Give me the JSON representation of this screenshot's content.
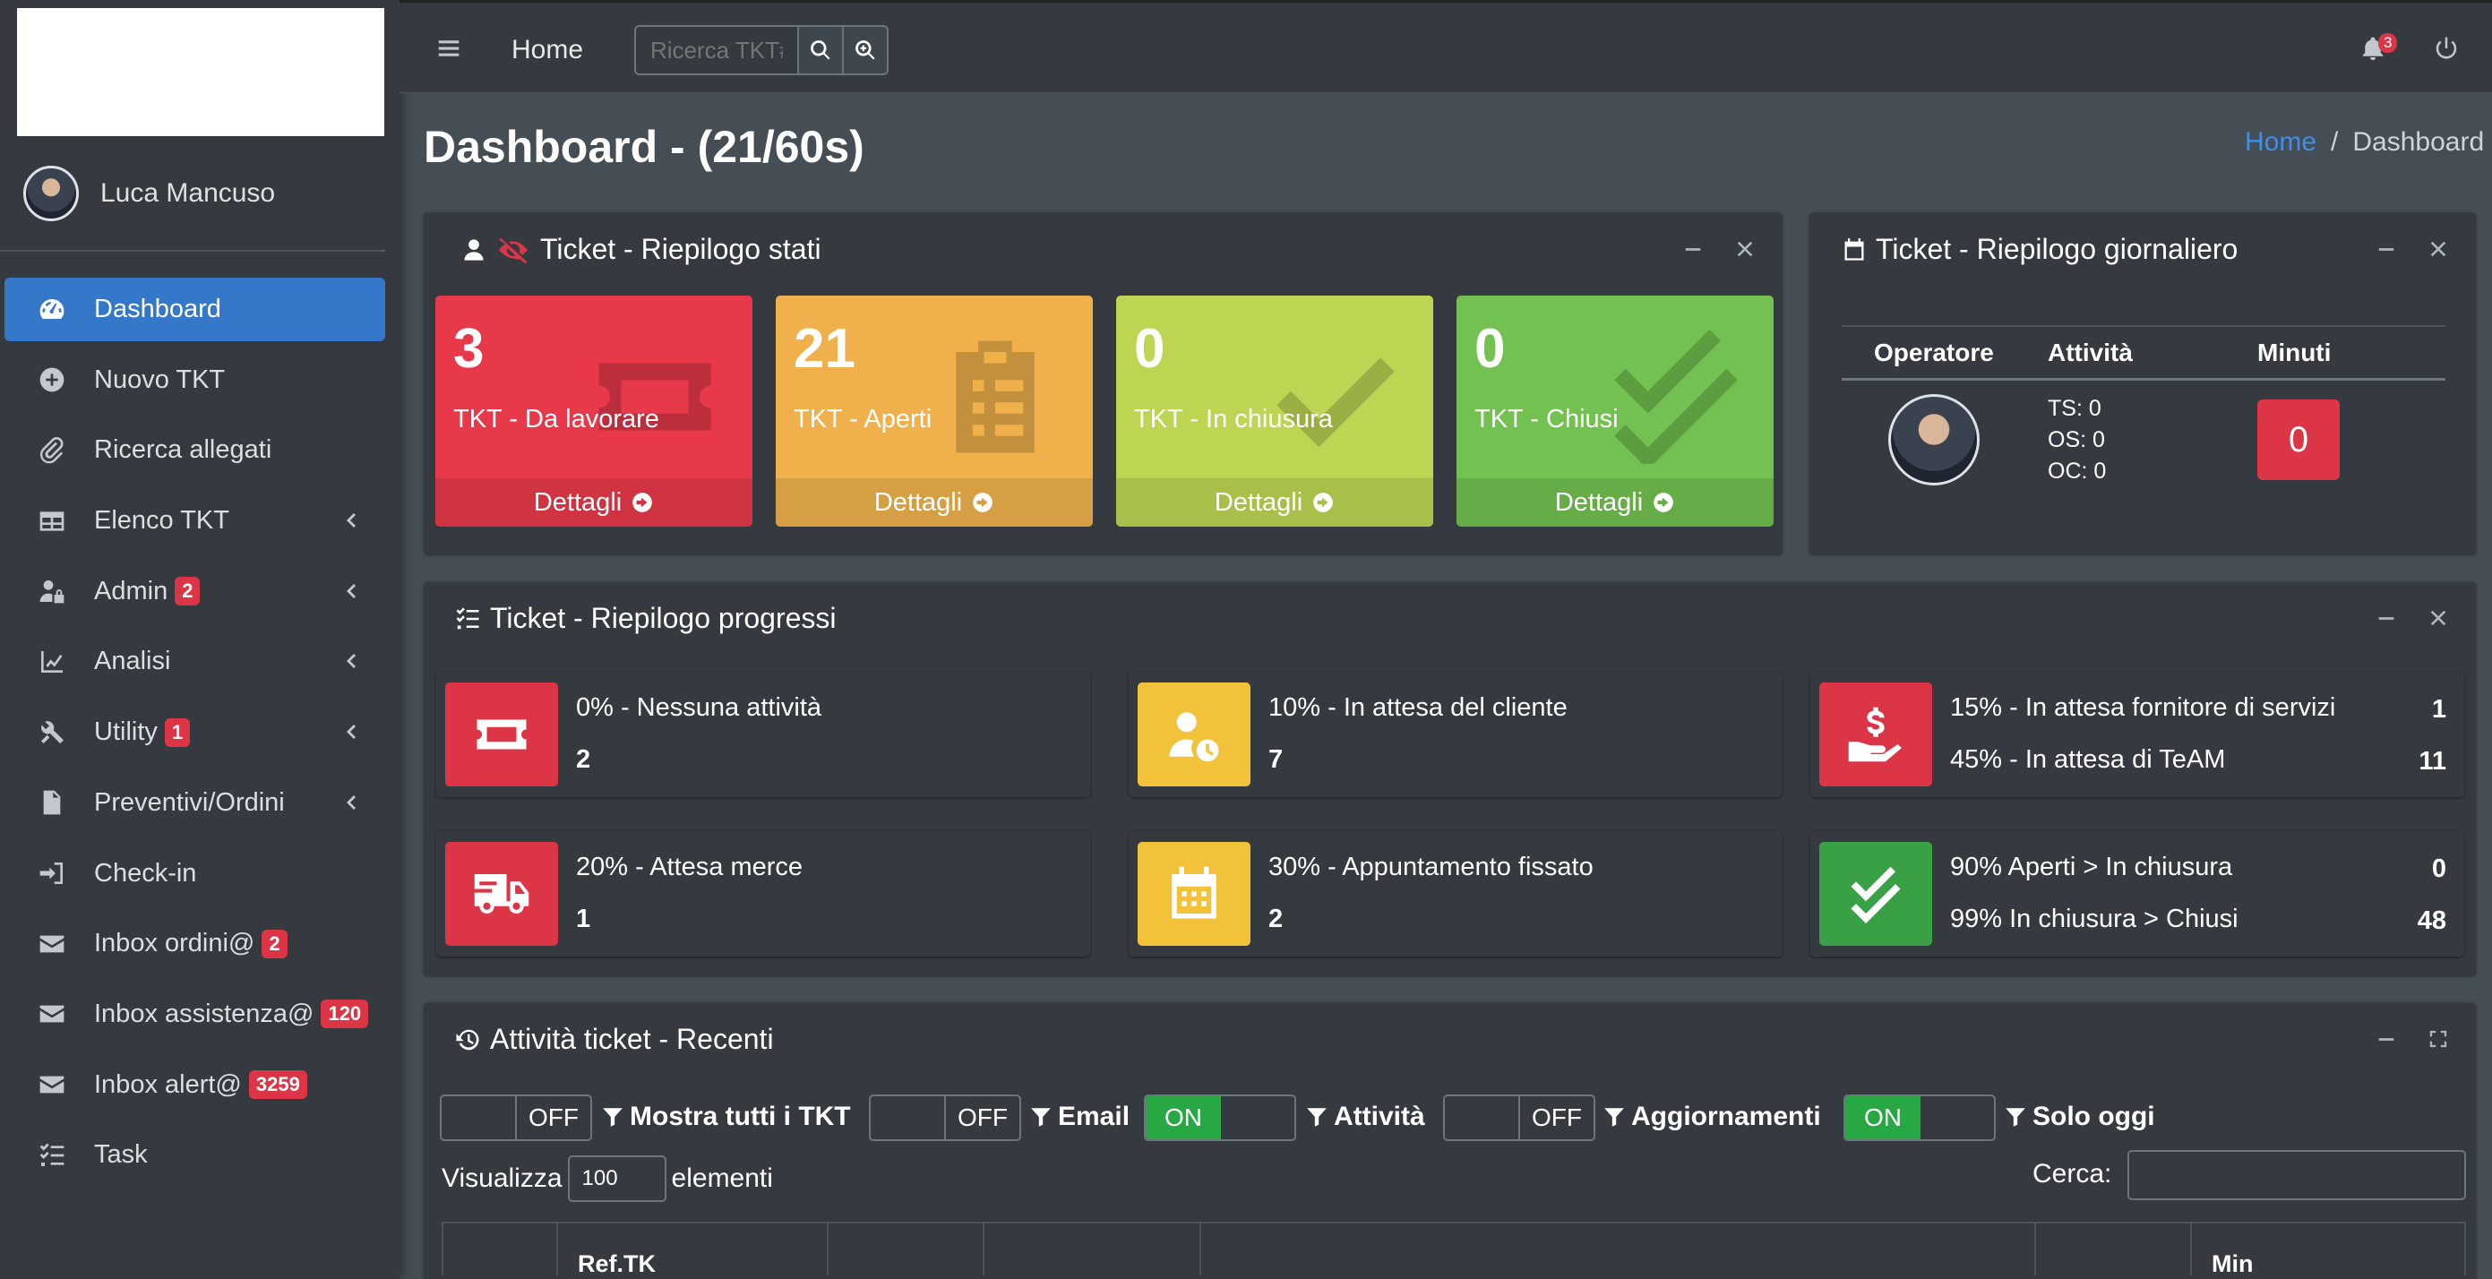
{
  "sidebar": {
    "user_name": "Luca Mancuso",
    "items": [
      {
        "label": "Dashboard",
        "icon": "tachometer-icon",
        "active": true
      },
      {
        "label": "Nuovo TKT",
        "icon": "plus-circle-icon"
      },
      {
        "label": "Ricerca allegati",
        "icon": "paperclip-icon"
      },
      {
        "label": "Elenco TKT",
        "icon": "table-icon",
        "chevron": true
      },
      {
        "label": "Admin",
        "icon": "user-lock-icon",
        "badge": "2",
        "chevron": true
      },
      {
        "label": "Analisi",
        "icon": "chart-line-icon",
        "chevron": true
      },
      {
        "label": "Utility",
        "icon": "tools-icon",
        "badge": "1",
        "chevron": true
      },
      {
        "label": "Preventivi/Ordini",
        "icon": "file-icon",
        "chevron": true
      },
      {
        "label": "Check-in",
        "icon": "sign-in-icon"
      },
      {
        "label": "Inbox ordini@",
        "icon": "envelope-icon",
        "badge": "2"
      },
      {
        "label": "Inbox assistenza@",
        "icon": "envelope-icon",
        "badge": "120"
      },
      {
        "label": "Inbox alert@",
        "icon": "envelope-icon",
        "badge": "3259"
      },
      {
        "label": "Task",
        "icon": "tasks-icon"
      }
    ]
  },
  "topbar": {
    "home": "Home",
    "search_placeholder": "Ricerca TKT#",
    "notifications": "3"
  },
  "page": {
    "title": "Dashboard - (21/60s)",
    "breadcrumb_home": "Home",
    "breadcrumb_sep": "/",
    "breadcrumb_current": "Dashboard"
  },
  "stati": {
    "title": "Ticket - Riepilogo stati",
    "boxes": [
      {
        "value": "3",
        "label": "TKT - Da lavorare",
        "footer": "Dettagli",
        "color": "#e8394a"
      },
      {
        "value": "21",
        "label": "TKT - Aperti",
        "footer": "Dettagli",
        "color": "#f0b14c"
      },
      {
        "value": "0",
        "label": "TKT - In chiusura",
        "footer": "Dettagli",
        "color": "#bcd653"
      },
      {
        "value": "0",
        "label": "TKT - Chiusi",
        "footer": "Dettagli",
        "color": "#73c150"
      }
    ]
  },
  "giornaliero": {
    "title": "Ticket - Riepilogo giornaliero",
    "col_operatore": "Operatore",
    "col_attivita": "Attività",
    "col_minuti": "Minuti",
    "ts": "TS: 0",
    "os": "OS: 0",
    "oc": "OC: 0",
    "minuti": "0"
  },
  "progressi": {
    "title": "Ticket - Riepilogo progressi",
    "nessuna": {
      "label": "0% - Nessuna attività",
      "value": "2"
    },
    "cliente": {
      "label": "10% - In attesa del cliente",
      "value": "7"
    },
    "fornitore": {
      "label": "15% - In attesa fornitore di servizi",
      "value": "1"
    },
    "team": {
      "label": "45% - In attesa di TeAM",
      "value": "11"
    },
    "merce": {
      "label": "20% - Attesa merce",
      "value": "1"
    },
    "appuntamento": {
      "label": "30% - Appuntamento fissato",
      "value": "2"
    },
    "aperti_chiusura": {
      "label": "90% Aperti > In chiusura",
      "value": "0"
    },
    "chiusura_chiusi": {
      "label": "99% In chiusura > Chiusi",
      "value": "48"
    }
  },
  "recenti": {
    "title": "Attività ticket - Recenti",
    "filters": [
      {
        "state": "OFF",
        "label": "Mostra tutti i TKT"
      },
      {
        "state": "OFF",
        "label": "Email"
      },
      {
        "state": "ON",
        "label": "Attività"
      },
      {
        "state": "OFF",
        "label": "Aggiornamenti"
      },
      {
        "state": "ON",
        "label": "Solo oggi"
      }
    ],
    "visualizza": "Visualizza",
    "page_size": "100",
    "elementi": "elementi",
    "cerca": "Cerca:",
    "col_ref": "Ref.TK",
    "col_min": "Min"
  }
}
